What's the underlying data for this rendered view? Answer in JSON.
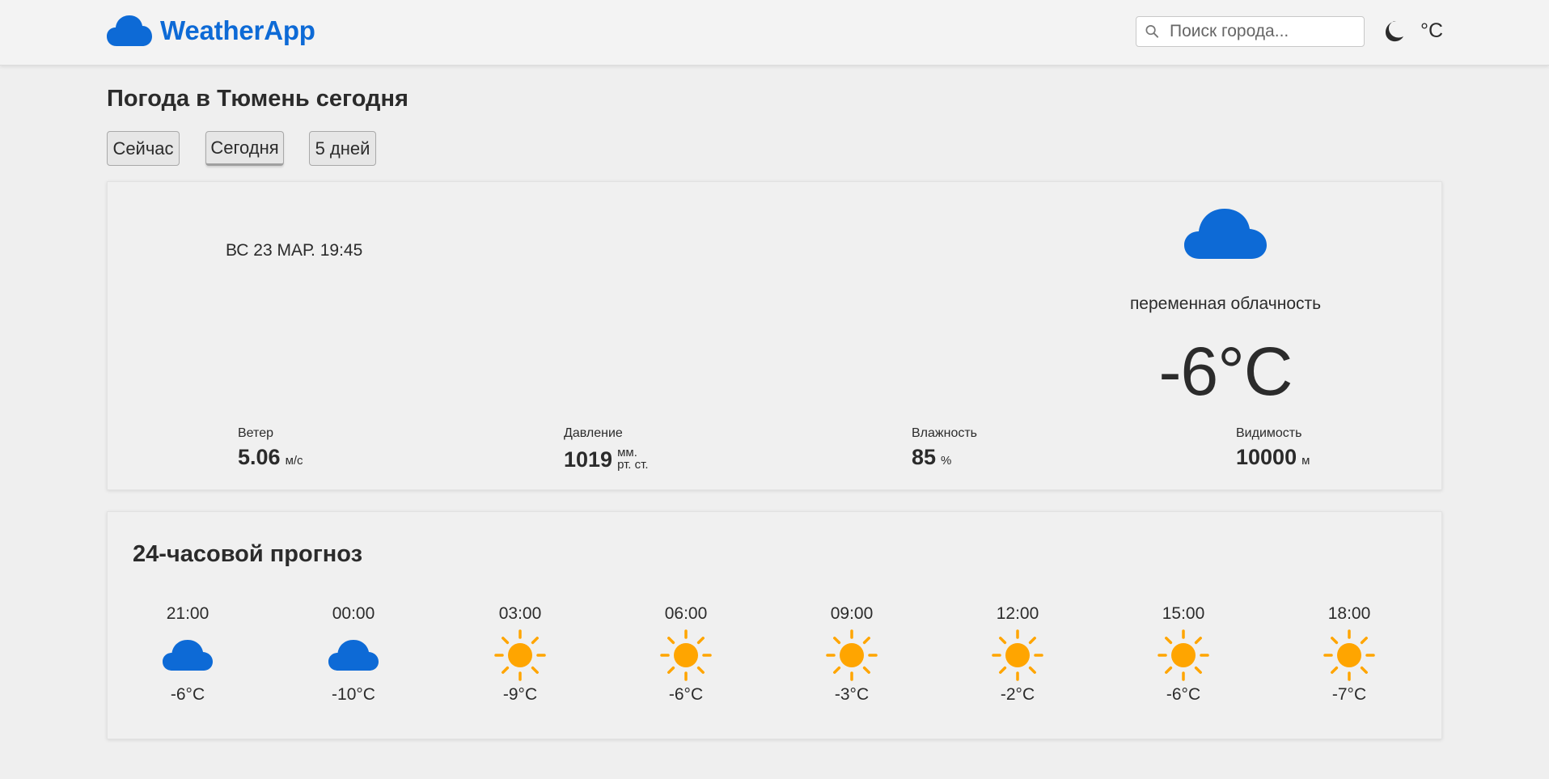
{
  "header": {
    "logo_text": "WeatherApp",
    "logo_icon": "cloud-icon",
    "search": {
      "placeholder": "Поиск города...",
      "value": "",
      "icon": "search-icon"
    },
    "theme_icon": "moon-icon",
    "unit_label": "°C"
  },
  "colors": {
    "brand": "#0d6ad6",
    "sun": "#ffa500",
    "background": "#efefef"
  },
  "page_title": "Погода в Тюмень сегодня",
  "tabs": [
    {
      "label": "Сейчас",
      "active": false
    },
    {
      "label": "Сегодня",
      "active": true
    },
    {
      "label": "5 дней",
      "active": false
    }
  ],
  "current": {
    "datetime": "ВС 23 МАР. 19:45",
    "icon": "cloud-icon",
    "condition": "переменная облачность",
    "temperature": "-6°C",
    "stats": [
      {
        "label": "Ветер",
        "value": "5.06",
        "unit": "м/с"
      },
      {
        "label": "Давление",
        "value": "1019",
        "unit_line1": "мм.",
        "unit_line2": "рт. ст."
      },
      {
        "label": "Влажность",
        "value": "85",
        "unit": "%"
      },
      {
        "label": "Видимость",
        "value": "10000",
        "unit": "м"
      }
    ]
  },
  "forecast": {
    "title": "24-часовой прогноз",
    "hours": [
      {
        "time": "21:00",
        "icon": "cloud-icon",
        "temp": "-6°C"
      },
      {
        "time": "00:00",
        "icon": "cloud-icon",
        "temp": "-10°C"
      },
      {
        "time": "03:00",
        "icon": "sun-icon",
        "temp": "-9°C"
      },
      {
        "time": "06:00",
        "icon": "sun-icon",
        "temp": "-6°C"
      },
      {
        "time": "09:00",
        "icon": "sun-icon",
        "temp": "-3°C"
      },
      {
        "time": "12:00",
        "icon": "sun-icon",
        "temp": "-2°C"
      },
      {
        "time": "15:00",
        "icon": "sun-icon",
        "temp": "-6°C"
      },
      {
        "time": "18:00",
        "icon": "sun-icon",
        "temp": "-7°C"
      }
    ]
  }
}
